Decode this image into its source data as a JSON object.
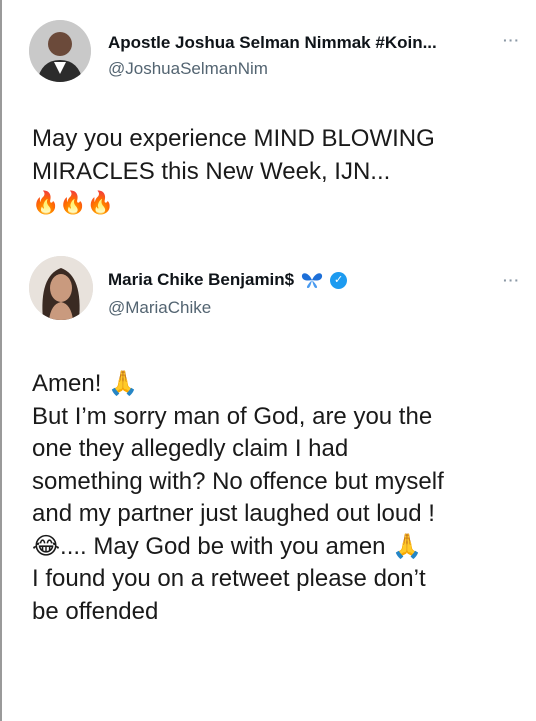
{
  "tweets": [
    {
      "display_name": "Apostle Joshua Selman Nimmak #Koin...",
      "handle": "@JoshuaSelmanNim",
      "more_icon": "more-options-icon",
      "more_label": "···",
      "body_lines": [
        "May you experience MIND BLOWING",
        "MIRACLES this New Week, IJN...",
        "🔥🔥🔥"
      ]
    },
    {
      "display_name": "Maria Chike Benjamin$",
      "handle": "@MariaChike",
      "more_label": "···",
      "badges": [
        "butterfly-icon",
        "verified-icon"
      ],
      "badge_colors": {
        "butterfly": "#1d6fd8",
        "verified": "#1d9bf0"
      },
      "body_lines": [
        "Amen! 🙏",
        "But I’m sorry man of God, are you the",
        "one they allegedly claim I had",
        "something with? No offence but myself",
        "and my partner just laughed out loud !",
        "😂.... May God be with you amen 🙏",
        "I found you on a retweet please don’t",
        "be offended"
      ]
    }
  ]
}
